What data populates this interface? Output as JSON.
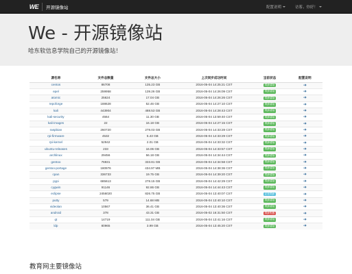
{
  "navbar": {
    "logo_text": "WE",
    "brand": "开源镜像站",
    "links": [
      {
        "label": "配置说明",
        "has_caret": true
      },
      {
        "label": "访客，你好！",
        "has_caret": true
      }
    ]
  },
  "jumbotron": {
    "title": "We - 开源镜像站",
    "subtitle": "哈东软信息学院自己的开源镜像站！"
  },
  "table": {
    "headers": [
      "源名称",
      "文件总数量",
      "文件总大小",
      "上次同步成功时间",
      "当前状态",
      "配置说明"
    ],
    "status_colors": {
      "green": "#5cb85c",
      "blue": "#5bc0de",
      "red": "#d9534f"
    },
    "rows": [
      {
        "name": "centos",
        "files": "86708",
        "size": "135.23 GB",
        "time": "2016-05-04 14:25:21 CST",
        "status": "同步成功",
        "color": "green"
      },
      {
        "name": "epel",
        "files": "259958",
        "size": "139.26 GB",
        "time": "2016-05-04 14:26:09 CST",
        "status": "同步成功",
        "color": "green"
      },
      {
        "name": "atomic",
        "files": "25624",
        "size": "17.04 GB",
        "time": "2016-05-04 14:26:26 CST",
        "status": "同步成功",
        "color": "green"
      },
      {
        "name": "repoforge",
        "files": "188628",
        "size": "52.46 GB",
        "time": "2016-05-04 14:27:10 CST",
        "status": "同步成功",
        "color": "green"
      },
      {
        "name": "kali",
        "files": "443904",
        "size": "488.53 GB",
        "time": "2016-05-04 14:28:43 CST",
        "status": "同步成功",
        "color": "green"
      },
      {
        "name": "kali-security",
        "files": "4564",
        "size": "11.30 GB",
        "time": "2016-05-04 13:59:40 CST",
        "status": "同步成功",
        "color": "green"
      },
      {
        "name": "kali-images",
        "files": "22",
        "size": "16.18 GB",
        "time": "2016-05-04 14:27:15 CST",
        "status": "同步成功",
        "color": "green"
      },
      {
        "name": "raspbian",
        "files": "260720",
        "size": "278.03 GB",
        "time": "2016-05-04 14:33:28 CST",
        "status": "同步成功",
        "color": "green"
      },
      {
        "name": "rpi-firmware",
        "files": "4532",
        "size": "5.43 GB",
        "time": "2016-05-04 14:33:29 CST",
        "status": "同步成功",
        "color": "green"
      },
      {
        "name": "rpi-kernel",
        "files": "52942",
        "size": "2.01 GB",
        "time": "2016-05-04 14:33:32 CST",
        "status": "同步成功",
        "color": "green"
      },
      {
        "name": "ubuntu-releases",
        "files": "233",
        "size": "16.06 GB",
        "time": "2016-05-04 14:33:57 CST",
        "status": "同步成功",
        "color": "green"
      },
      {
        "name": "archlinux",
        "files": "29456",
        "size": "56.18 GB",
        "time": "2016-05-04 14:34:44 CST",
        "status": "同步成功",
        "color": "green"
      },
      {
        "name": "gentoo",
        "files": "76931",
        "size": "333.81 GB",
        "time": "2016-05-04 14:34:58 CST",
        "status": "同步成功",
        "color": "green"
      },
      {
        "name": "gentoo-portage",
        "files": "180976",
        "size": "434.97 MB",
        "time": "2016-05-04 14:38:36 CST",
        "status": "同步成功",
        "color": "green"
      },
      {
        "name": "cpan",
        "files": "336733",
        "size": "19.75 GB",
        "time": "2016-05-04 14:39:20 CST",
        "status": "同步成功",
        "color": "green"
      },
      {
        "name": "pypi",
        "files": "685613",
        "size": "278.15 GB",
        "time": "2016-05-04 14:42:29 CST",
        "status": "同步成功",
        "color": "green"
      },
      {
        "name": "cygwin",
        "files": "91146",
        "size": "92.86 GB",
        "time": "2016-05-04 14:44:43 CST",
        "status": "同步成功",
        "color": "green"
      },
      {
        "name": "eclipse",
        "files": "2456020",
        "size": "826.75 GB",
        "time": "2016-05-04 13:40:07 CST",
        "status": "正在同步",
        "color": "blue"
      },
      {
        "name": "putty",
        "files": "579",
        "size": "14.68 MB",
        "time": "2016-05-04 13:40:10 CST",
        "status": "同步成功",
        "color": "green"
      },
      {
        "name": "videolan",
        "files": "10567",
        "size": "36.41 GB",
        "time": "2016-05-04 13:40:36 CST",
        "status": "同步成功",
        "color": "green"
      },
      {
        "name": "android",
        "files": "378",
        "size": "43.31 GB",
        "time": "2016-05-02 16:31:50 CST",
        "status": "同步失败",
        "color": "red"
      },
      {
        "name": "qt",
        "files": "14719",
        "size": "111.04 GB",
        "time": "2016-05-04 13:41:16 CST",
        "status": "同步成功",
        "color": "green"
      },
      {
        "name": "ldp",
        "files": "80965",
        "size": "3.99 GB",
        "time": "2016-05-04 13:45:20 CST",
        "status": "同步成功",
        "color": "green"
      }
    ]
  },
  "section2": {
    "title": "教育网主要镜像站"
  }
}
